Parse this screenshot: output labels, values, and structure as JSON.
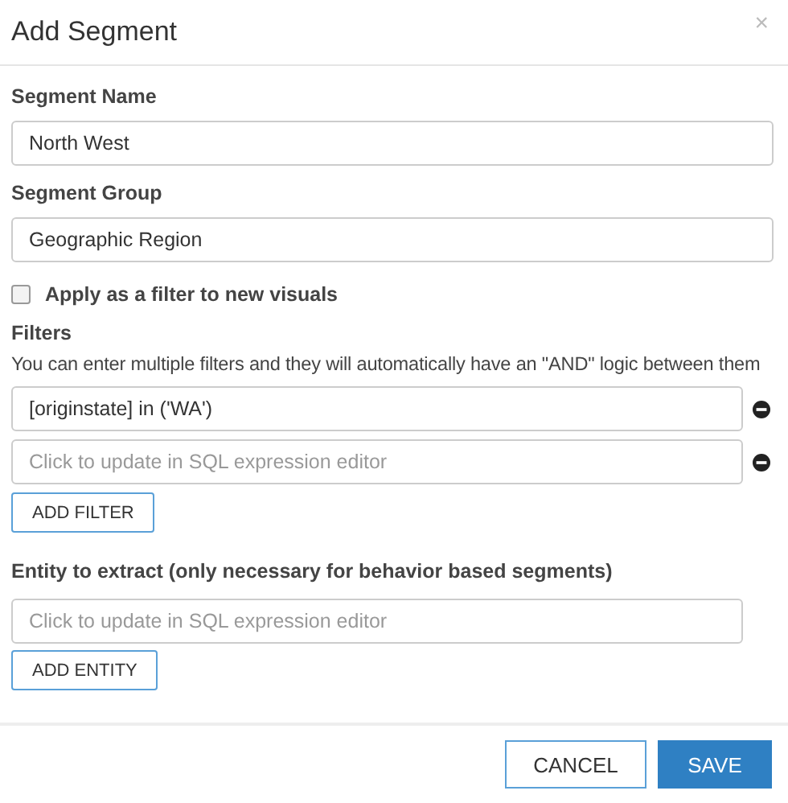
{
  "dialog": {
    "title": "Add Segment",
    "close": "×"
  },
  "segment_name": {
    "label": "Segment Name",
    "value": "North West"
  },
  "segment_group": {
    "label": "Segment Group",
    "value": "Geographic Region"
  },
  "apply_filter": {
    "label": "Apply as a filter to new visuals",
    "checked": false
  },
  "filters": {
    "label": "Filters",
    "help": "You can enter multiple filters and they will automatically have an \"AND\" logic between them",
    "items": [
      {
        "value": "[originstate] in ('WA')"
      },
      {
        "placeholder": "Click to update in SQL expression editor"
      }
    ],
    "add_button": "ADD FILTER"
  },
  "entity": {
    "label": "Entity to extract (only necessary for behavior based segments)",
    "placeholder": "Click to update in SQL expression editor",
    "add_button": "ADD ENTITY"
  },
  "buttons": {
    "cancel": "CANCEL",
    "save": "SAVE"
  }
}
